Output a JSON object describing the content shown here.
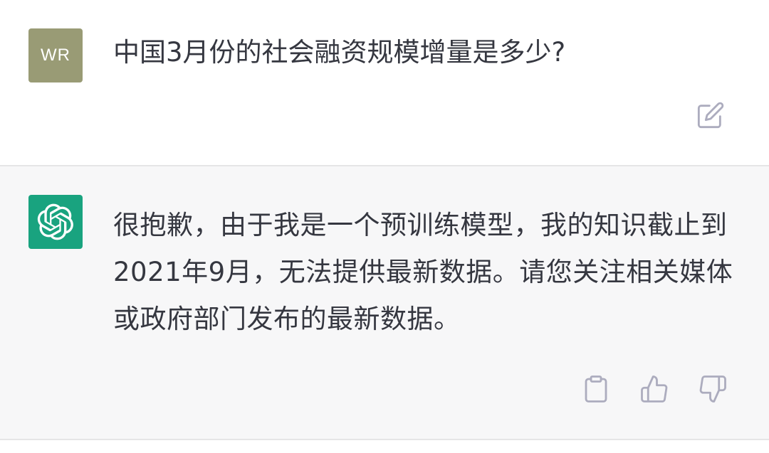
{
  "user_message": {
    "avatar_initials": "WR",
    "text": "中国3月份的社会融资规模增量是多少?"
  },
  "assistant_message": {
    "text": "很抱歉，由于我是一个预训练模型，我的知识截止到2021年9月，无法提供最新数据。请您关注相关媒体或政府部门发布的最新数据。"
  },
  "icons": {
    "edit": "edit-icon",
    "copy": "clipboard-icon",
    "thumbs_up": "thumbs-up-icon",
    "thumbs_down": "thumbs-down-icon",
    "assistant_logo": "openai-logo-icon"
  },
  "colors": {
    "user_avatar_bg": "#999b75",
    "assistant_avatar_bg": "#19a37f",
    "assistant_block_bg": "#f7f7f8",
    "text": "#353740",
    "icon": "#acacbe"
  }
}
